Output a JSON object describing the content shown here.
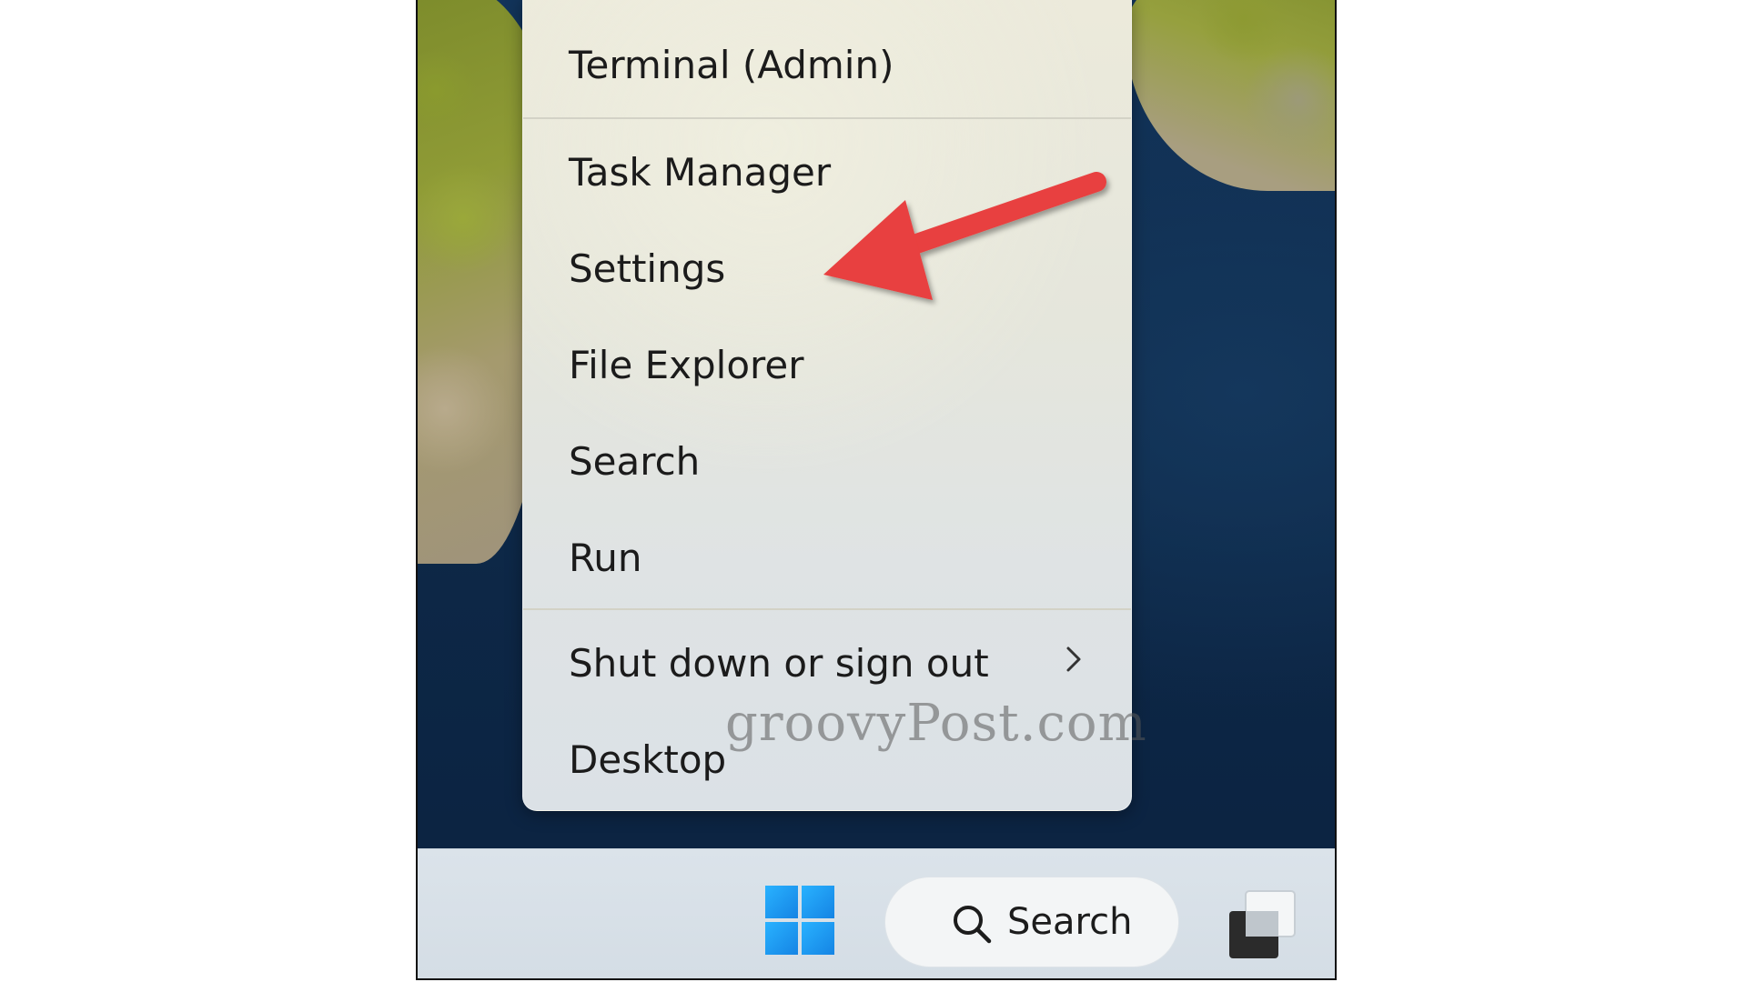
{
  "context_menu": {
    "items": [
      {
        "label": "Terminal (Admin)"
      },
      {
        "label": "Task Manager"
      },
      {
        "label": "Settings"
      },
      {
        "label": "File Explorer"
      },
      {
        "label": "Search"
      },
      {
        "label": "Run"
      },
      {
        "label": "Shut down or sign out",
        "submenu_icon": "chevron-right-icon"
      },
      {
        "label": "Desktop"
      }
    ]
  },
  "watermark": {
    "text": "groovyPost.com"
  },
  "annotation": {
    "arrow_color": "#e8413f",
    "points_to": "Settings"
  },
  "taskbar": {
    "start_icon": "windows-logo-icon",
    "search": {
      "label": "Search",
      "icon": "search-icon"
    },
    "task_view_icon": "task-view-icon"
  },
  "colors": {
    "windows_blue": "#1a90ef",
    "arrow_red": "#e8413f"
  }
}
